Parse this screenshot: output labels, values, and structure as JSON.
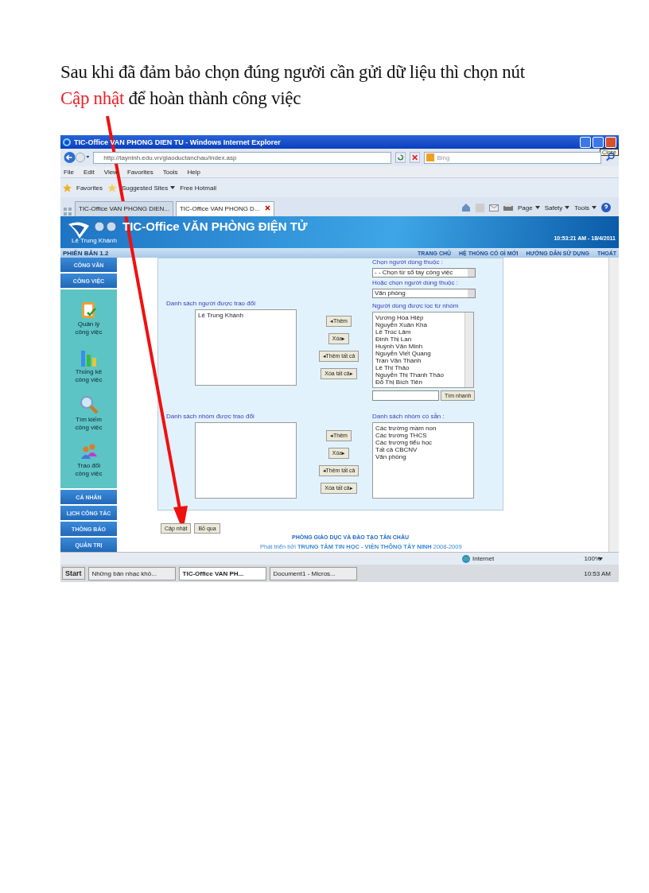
{
  "instruction": {
    "before": "Sau khi đã đảm bảo chọn đúng người cần gửi dữ liệu thì chọn nút",
    "highlight": "Cập nhật",
    "after": "để hoàn thành công việc"
  },
  "window": {
    "title": "TIC-Office VAN PHONG DIEN TU - Windows Internet Explorer",
    "tooltip": "Close"
  },
  "address": {
    "value": "http://tayninh.edu.vn/giaoductanchau/index.asp",
    "search_placeholder": "Bing"
  },
  "menu": [
    "File",
    "Edit",
    "View",
    "Favorites",
    "Tools",
    "Help"
  ],
  "favorites_bar": [
    "Favorites",
    "Suggested Sites",
    "Free Hotmail"
  ],
  "tabs": [
    {
      "label": "TIC-Office VAN PHONG DIEN...",
      "selected": false
    },
    {
      "label": "TIC-Office VAN PHONG D...",
      "selected": true
    }
  ],
  "command_bar": [
    "Page",
    "Safety",
    "Tools"
  ],
  "site": {
    "title": "TIC-Office VĂN PHÒNG ĐIỆN TỬ",
    "user": "Lê Trung Khánh",
    "datetime": "10:53:21 AM - 18/4/2011",
    "version": "PHIÊN BẢN 1.2",
    "nav": [
      "TRANG CHỦ",
      "HỆ THỐNG CÓ GÌ MỚI",
      "HƯỚNG DẪN SỬ DỤNG",
      "THOÁT"
    ]
  },
  "sidebar": {
    "top": [
      "CÔNG VĂN",
      "CÔNG VIỆC"
    ],
    "tools": [
      {
        "kind": "clipboard",
        "label": "Quản lý công việc"
      },
      {
        "kind": "chart",
        "label": "Thống kê công việc"
      },
      {
        "kind": "magnifier",
        "label": "Tìm kiếm công việc"
      },
      {
        "kind": "people",
        "label": "Trao đổi công việc"
      }
    ],
    "bottom": [
      "CÁ NHÂN",
      "LỊCH CÔNG TÁC",
      "THÔNG BÁO",
      "QUẢN TRỊ"
    ]
  },
  "form": {
    "people": {
      "label": "Danh sách người được trao đổi",
      "items": [
        "Lê Trung Khánh"
      ],
      "buttons": [
        "◂Thêm",
        "Xóa▸",
        "◂Thêm tất cả",
        "Xóa tất cả▸"
      ]
    },
    "groups": {
      "label": "Danh sách nhóm được trao đổi",
      "buttons": [
        "◂Thêm",
        "Xóa▸",
        "◂Thêm tất cả",
        "Xóa tất cả▸"
      ]
    },
    "filter_label": "Chọn người dùng thuộc :",
    "filter_select": "- - Chọn từ sổ tay công việc",
    "group_label": "Hoặc chọn người dùng thuộc :",
    "group_select": "Văn phòng",
    "users_label": "Người dùng được lọc từ nhóm",
    "users": [
      "Vương Hòa Hiệp",
      "Nguyễn Xuân Kha",
      "Lê Trúc Lâm",
      "Đinh Thị Lan",
      "Huỳnh Văn Minh",
      "Nguyễn Viết Quang",
      "Trần Văn Thành",
      "Lê Thị Thảo",
      "Nguyễn Thị Thanh Thảo",
      "Đỗ Thị Bích Tiên"
    ],
    "search_button": "Tìm nhanh",
    "available_label": "Danh sách nhóm có sẵn :",
    "available": [
      "Các trường mầm non",
      "Các trường THCS",
      "Các trường tiểu học",
      "Tất cả CBCNV",
      "Văn phòng"
    ]
  },
  "actions": [
    "Cập nhật",
    "Bỏ qua"
  ],
  "footer": {
    "org": "PHÒNG GIÁO DỤC VÀ ĐÀO TẠO TÂN CHÂU",
    "credit": "Phát triển bởi **TRUNG TÂM TIN HỌC - VIỄN THÔNG TÂY NINH** 2008-2009"
  },
  "status": {
    "zone": "Internet",
    "zoom": "100%"
  },
  "taskbar": {
    "start": "Start",
    "items": [
      {
        "label": "Những bản nhạc khô...",
        "selected": false
      },
      {
        "label": "TIC-Office VAN PH...",
        "selected": true
      },
      {
        "label": "Document1 - Micros...",
        "selected": false
      }
    ],
    "clock": "10:53 AM"
  }
}
